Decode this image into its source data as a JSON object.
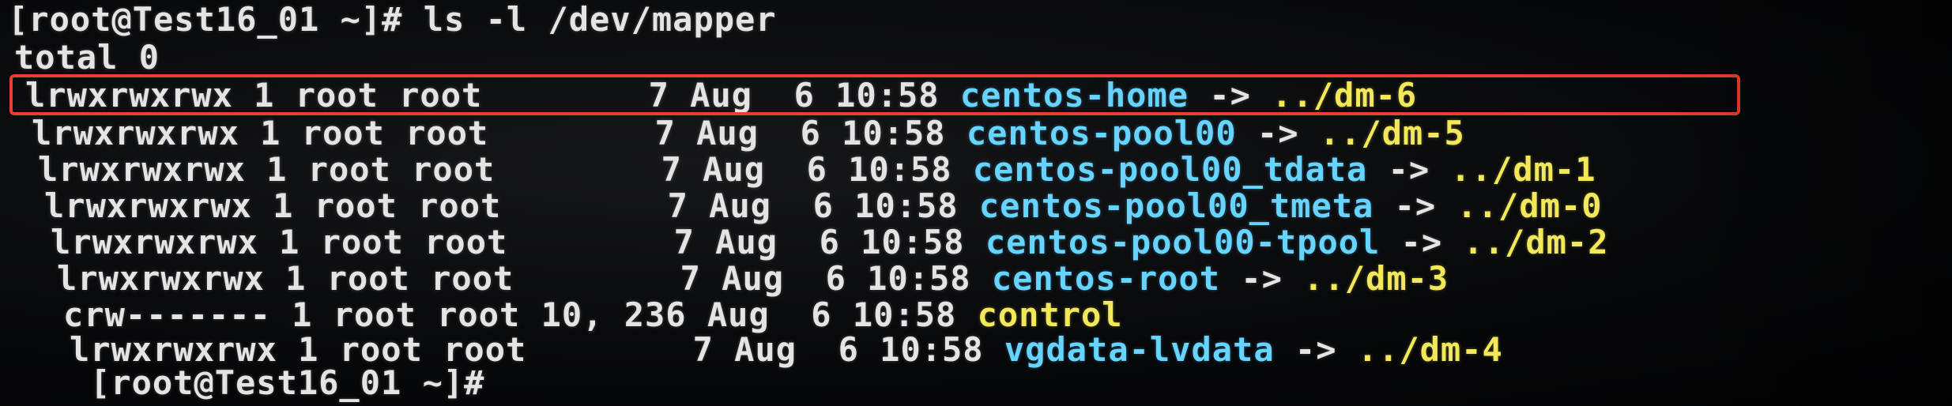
{
  "terminal": {
    "command_line": "[root@Test16_01 ~]# ls -l /dev/mapper",
    "total_line": "total 0",
    "entries": [
      {
        "meta": "lrwxrwxrwx 1 root root        7 Aug  6 10:58 ",
        "name": "centos-home",
        "arrow": " -> ",
        "target": "../dm-6"
      },
      {
        "meta": "lrwxrwxrwx 1 root root        7 Aug  6 10:58 ",
        "name": "centos-pool00",
        "arrow": " -> ",
        "target": "../dm-5"
      },
      {
        "meta": "lrwxrwxrwx 1 root root        7 Aug  6 10:58 ",
        "name": "centos-pool00_tdata",
        "arrow": " -> ",
        "target": "../dm-1"
      },
      {
        "meta": "lrwxrwxrwx 1 root root        7 Aug  6 10:58 ",
        "name": "centos-pool00_tmeta",
        "arrow": " -> ",
        "target": "../dm-0"
      },
      {
        "meta": "lrwxrwxrwx 1 root root        7 Aug  6 10:58 ",
        "name": "centos-pool00-tpool",
        "arrow": " -> ",
        "target": "../dm-2"
      },
      {
        "meta": "lrwxrwxrwx 1 root root        7 Aug  6 10:58 ",
        "name": "centos-root",
        "arrow": " -> ",
        "target": "../dm-3"
      },
      {
        "meta": "crw------- 1 root root 10, 236 Aug  6 10:58 ",
        "name": "control"
      },
      {
        "meta": "lrwxrwxrwx 1 root root        7 Aug  6 10:58 ",
        "name": "vgdata-lvdata",
        "arrow": " -> ",
        "target": "../dm-4"
      }
    ],
    "prompt": "[root@Test16_01 ~]#"
  },
  "colors": {
    "text": "#e4e4e4",
    "symlink_name": "#66d4ff",
    "symlink_target": "#f2e85a",
    "device_name": "#f2e85a",
    "highlight_box": "#e8402c"
  }
}
